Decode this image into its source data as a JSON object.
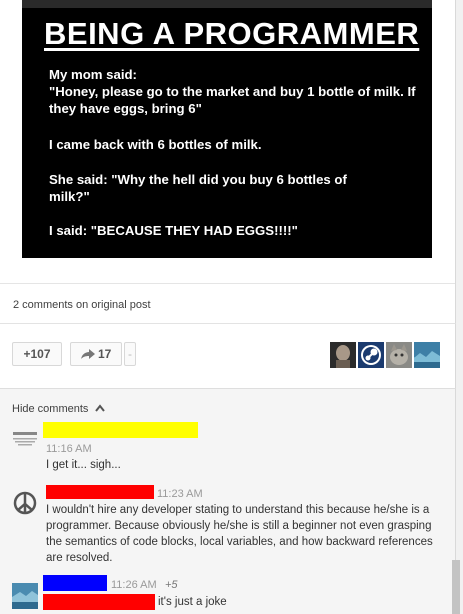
{
  "meme": {
    "title": "BEING A PROGRAMMER",
    "line1": "My mom said:",
    "line2": "\"Honey, please go to the market and buy 1 bottle of milk. If they have eggs, bring 6\"",
    "line3": "I came back with 6 bottles of milk.",
    "line4": "She said: \"Why the hell did you buy 6 bottles of milk?\"",
    "line5": "I said: \"BECAUSE THEY HAD EGGS!!!!\""
  },
  "post": {
    "comments_on_original": "2 comments on original post",
    "plus_count": "+107",
    "share_count": "17",
    "more_label": "-",
    "sharer_avatars": [
      "face-avatar",
      "steam-avatar",
      "cat-avatar",
      "landscape-avatar"
    ]
  },
  "comments": {
    "hide_label": "Hide comments",
    "items": [
      {
        "time": "11:16 AM",
        "text": "I get it... sigh...",
        "redact_color": "#ffff00"
      },
      {
        "time": "11:23 AM",
        "text": "I wouldn't hire any developer stating to understand this because he/she is a programmer. Because obviously he/she is still a beginner not even grasping the semantics of code blocks, local variables, and how backward references are resolved.",
        "redact_color": "#ff0000"
      },
      {
        "time": "11:26 AM",
        "plus": "+5",
        "text": "it's just a joke",
        "redact_color": "#0000ff",
        "redact_color2": "#ff0000"
      }
    ]
  },
  "colors": {
    "page_bg": "#f1f1f1",
    "card_bg": "#ffffff",
    "meme_bg": "#000000"
  }
}
